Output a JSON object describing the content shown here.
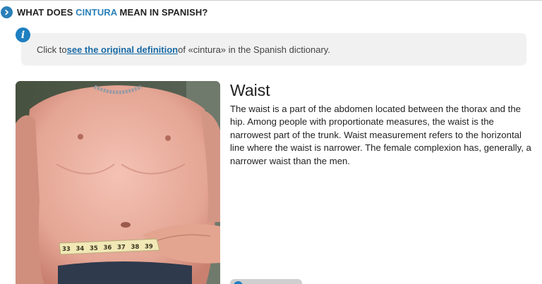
{
  "section": {
    "title_prefix": "WHAT DOES ",
    "keyword": "CINTURA",
    "title_suffix": " MEAN IN SPANISH?"
  },
  "info": {
    "prefix": "Click to ",
    "link_text": "see the original definition",
    "suffix": " of «cintura» in the Spanish dictionary."
  },
  "entry": {
    "title": "Waist",
    "text": "The waist is a part of the abdomen located between the thorax and the hip. Among people with proportionate measures, the waist is the narrowest part of the trunk. Waist measurement refers to the horizontal line where the waist is narrower. The female complexion has, generally, a narrower waist than the men."
  },
  "tape": {
    "marks": [
      "33",
      "34",
      "35",
      "36",
      "37",
      "38",
      "39"
    ]
  },
  "colors": {
    "accent": "#2a7fb8",
    "link": "#1a6aa5",
    "info_bg": "#f1f1f1"
  },
  "icons": {
    "header": "chevron-right-icon",
    "info": "info-icon"
  }
}
